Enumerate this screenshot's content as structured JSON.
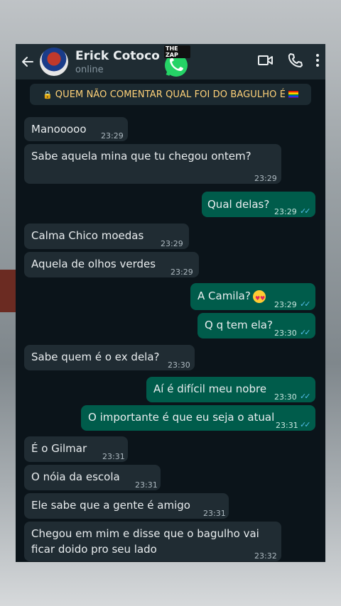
{
  "header": {
    "contact_name": "Erick Cotoco",
    "status": "online",
    "logo_text": "THE ZAP"
  },
  "banner": {
    "text": "QUEM NÃO COMENTAR QUAL FOI DO BAGULHO É"
  },
  "messages": [
    {
      "dir": "in",
      "text": "Manooooo",
      "time": "23:29"
    },
    {
      "dir": "in",
      "text": "Sabe aquela mina que tu chegou ontem?",
      "time": "23:29"
    },
    {
      "dir": "out",
      "text": "Qual delas?",
      "time": "23:29",
      "ticks": "✓✓"
    },
    {
      "dir": "in",
      "text": "Calma Chico moedas",
      "time": "23:29"
    },
    {
      "dir": "in",
      "text": "Aquela de olhos verdes",
      "time": "23:29"
    },
    {
      "dir": "out",
      "text": "A Camila?",
      "time": "23:29",
      "ticks": "✓✓"
    },
    {
      "dir": "out",
      "text": "Q q tem ela?",
      "time": "23:30",
      "ticks": "✓✓"
    },
    {
      "dir": "in",
      "text": "Sabe quem é o ex dela?",
      "time": "23:30"
    },
    {
      "dir": "out",
      "text": "Aí é difícil meu nobre",
      "time": "23:30",
      "ticks": "✓✓"
    },
    {
      "dir": "out",
      "text": "O importante é que eu seja o atual",
      "time": "23:31",
      "ticks": "✓✓"
    },
    {
      "dir": "in",
      "text": "É o Gilmar",
      "time": "23:31"
    },
    {
      "dir": "in",
      "text": "O nóia da escola",
      "time": "23:31"
    },
    {
      "dir": "in",
      "text": "Ele sabe que a gente é amigo",
      "time": "23:31"
    },
    {
      "dir": "in",
      "text": "Chegou em mim e disse que o bagulho vai ficar doido pro seu lado",
      "time": "23:32"
    }
  ],
  "colors": {
    "header_bg": "#1f2c33",
    "chat_bg": "#0b141a",
    "incoming_bubble": "#202c33",
    "outgoing_bubble": "#005c4b",
    "read_ticks": "#53bdeb",
    "banner_text": "#ffd279"
  },
  "icons": [
    "back-arrow-icon",
    "video-call-icon",
    "phone-icon",
    "more-options-icon",
    "lock-icon",
    "rainbow-flag-icon",
    "heart-eyes-emoji-icon",
    "whatsapp-logo-icon"
  ]
}
